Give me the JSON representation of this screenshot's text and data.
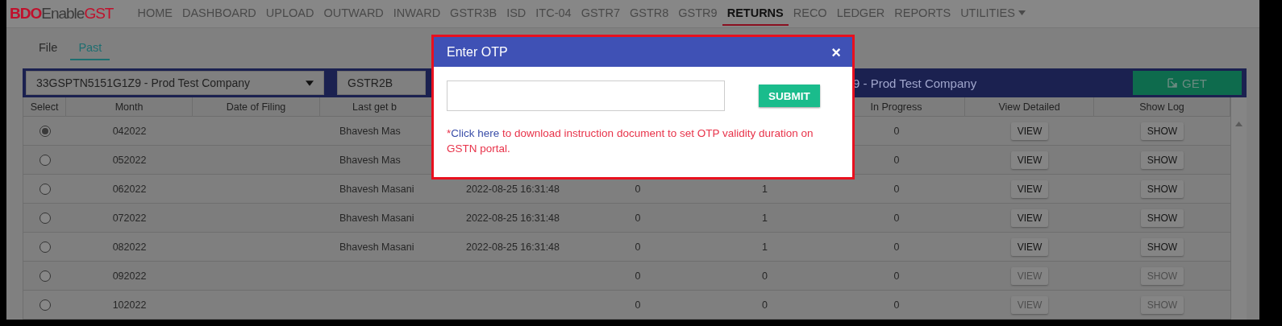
{
  "nav": {
    "logo": {
      "brand": "BDO",
      "product": "Enable",
      "suffix": "GST"
    },
    "items": [
      {
        "label": "HOME",
        "selected": false
      },
      {
        "label": "DASHBOARD",
        "selected": false
      },
      {
        "label": "UPLOAD",
        "selected": false
      },
      {
        "label": "OUTWARD",
        "selected": false
      },
      {
        "label": "INWARD",
        "selected": false
      },
      {
        "label": "GSTR3B",
        "selected": false
      },
      {
        "label": "ISD",
        "selected": false
      },
      {
        "label": "ITC-04",
        "selected": false
      },
      {
        "label": "GSTR7",
        "selected": false
      },
      {
        "label": "GSTR8",
        "selected": false
      },
      {
        "label": "GSTR9",
        "selected": false
      },
      {
        "label": "RETURNS",
        "selected": true
      },
      {
        "label": "RECO",
        "selected": false
      },
      {
        "label": "LEDGER",
        "selected": false
      },
      {
        "label": "REPORTS",
        "selected": false
      },
      {
        "label": "UTILITIES",
        "selected": false,
        "dropdown": true
      }
    ]
  },
  "tabs": [
    {
      "label": "File",
      "selected": false
    },
    {
      "label": "Past",
      "selected": true
    }
  ],
  "filter_bar": {
    "company_select": "33GSPTN5151G1Z9 - Prod Test Company",
    "return_select": "GSTR2B",
    "title": "9 - Prod Test Company",
    "get_button": "GET"
  },
  "table": {
    "columns": [
      "Select",
      "Month",
      "Date of Filing",
      "Last get b",
      "",
      "",
      "",
      "In Progress",
      "View Detailed",
      "Show Log"
    ],
    "rows": [
      {
        "selected": true,
        "month": "042022",
        "last_get_by": "Bhavesh Mas",
        "in_progress": "0",
        "view": {
          "label": "VIEW",
          "disabled": false
        },
        "show": {
          "label": "SHOW",
          "disabled": false
        }
      },
      {
        "selected": false,
        "month": "052022",
        "last_get_by": "Bhavesh Mas",
        "in_progress": "0",
        "view": {
          "label": "VIEW",
          "disabled": false
        },
        "show": {
          "label": "SHOW",
          "disabled": false
        }
      },
      {
        "selected": false,
        "month": "062022",
        "last_get_by": "Bhavesh Masani",
        "column_5": "2022-08-25 16:31:48",
        "column_6": "0",
        "column_7": "1",
        "in_progress": "0",
        "view": {
          "label": "VIEW",
          "disabled": false
        },
        "show": {
          "label": "SHOW",
          "disabled": false
        }
      },
      {
        "selected": false,
        "month": "072022",
        "last_get_by": "Bhavesh Masani",
        "column_5": "2022-08-25 16:31:48",
        "column_6": "0",
        "column_7": "1",
        "in_progress": "0",
        "view": {
          "label": "VIEW",
          "disabled": false
        },
        "show": {
          "label": "SHOW",
          "disabled": false
        }
      },
      {
        "selected": false,
        "month": "082022",
        "last_get_by": "Bhavesh Masani",
        "column_5": "2022-08-25 16:31:48",
        "column_6": "0",
        "column_7": "1",
        "in_progress": "0",
        "view": {
          "label": "VIEW",
          "disabled": false
        },
        "show": {
          "label": "SHOW",
          "disabled": false
        }
      },
      {
        "selected": false,
        "month": "092022",
        "column_6": "0",
        "column_7": "0",
        "in_progress": "0",
        "view": {
          "label": "VIEW",
          "disabled": true
        },
        "show": {
          "label": "SHOW",
          "disabled": true
        }
      },
      {
        "selected": false,
        "month": "102022",
        "column_6": "0",
        "column_7": "0",
        "in_progress": "0",
        "view": {
          "label": "VIEW",
          "disabled": true
        },
        "show": {
          "label": "SHOW",
          "disabled": true
        }
      }
    ]
  },
  "modal": {
    "title": "Enter OTP",
    "close": "×",
    "submit": "SUBMIT",
    "note": {
      "prefix": "*",
      "link": "Click here",
      "text": " to download instruction document to set OTP validity duration on GSTN portal."
    }
  }
}
